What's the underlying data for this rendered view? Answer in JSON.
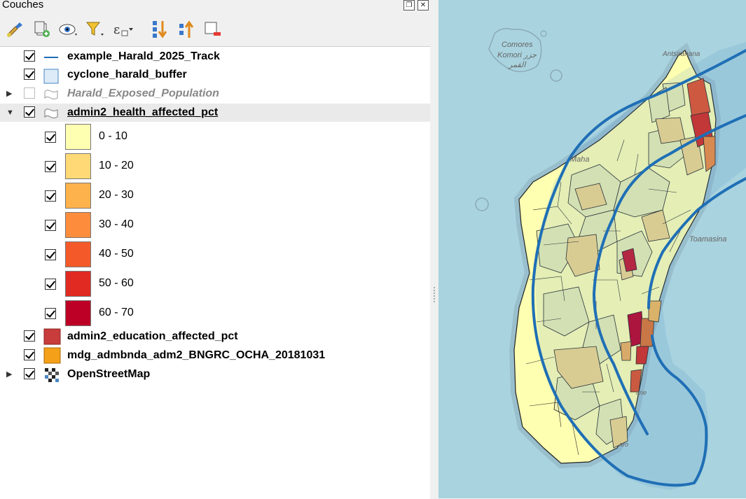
{
  "panel": {
    "title": "Couches",
    "title_buttons": [
      "restore-icon",
      "close-icon"
    ]
  },
  "toolbar": {
    "buttons": [
      {
        "name": "style-manager-icon"
      },
      {
        "name": "add-group-icon"
      },
      {
        "name": "manage-visibility-icon"
      },
      {
        "name": "filter-legend-icon"
      },
      {
        "name": "filter-expression-icon"
      },
      {
        "name": "expand-all-icon"
      },
      {
        "name": "collapse-all-icon"
      },
      {
        "name": "remove-layer-icon"
      }
    ]
  },
  "layers": [
    {
      "name": "example_Harald_2025_Track",
      "checked": true,
      "type": "line",
      "color": "#1f6fb5"
    },
    {
      "name": "cyclone_harald_buffer",
      "checked": true,
      "type": "polygon-fill",
      "color": "#dcebf7"
    },
    {
      "name": "Harald_Exposed_Population",
      "checked": false,
      "type": "polygon-outline",
      "expandable": true
    },
    {
      "name": "admin2_health_affected_pct",
      "checked": true,
      "type": "polygon-outline",
      "expanded": true,
      "selected": true
    },
    {
      "name": "admin2_education_affected_pct",
      "checked": true,
      "type": "fill",
      "color": "#c83c3c"
    },
    {
      "name": "mdg_admbnda_adm2_BNGRC_OCHA_20181031",
      "checked": true,
      "type": "fill",
      "color": "#f5a019"
    },
    {
      "name": "OpenStreetMap",
      "checked": true,
      "type": "raster",
      "expandable": true
    }
  ],
  "legend": [
    {
      "label": "0 - 10",
      "color": "#ffffb2"
    },
    {
      "label": "10 - 20",
      "color": "#fed976"
    },
    {
      "label": "20 - 30",
      "color": "#feb24c"
    },
    {
      "label": "30 - 40",
      "color": "#fd8d3c"
    },
    {
      "label": "40 - 50",
      "color": "#f45a29"
    },
    {
      "label": "50 - 60",
      "color": "#e02a22"
    },
    {
      "label": "60 - 70",
      "color": "#bd0026"
    }
  ],
  "map": {
    "labels": {
      "comores_1": "Comores",
      "comores_2": "Komori جزر",
      "comores_3": "القمر",
      "antsiranana": "Antsiranana",
      "mahajanga": "Maha",
      "toamasina": "Toamasina",
      "ane": "ane",
      "aro": "aro"
    }
  }
}
